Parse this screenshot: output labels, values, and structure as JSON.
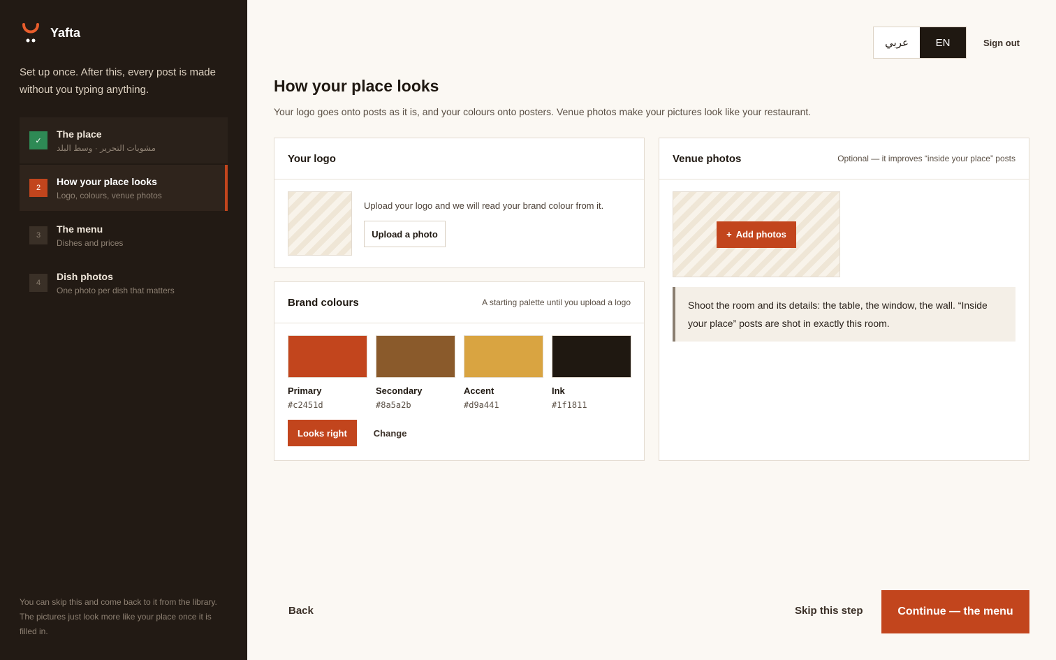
{
  "app": {
    "name": "Yafta"
  },
  "sidebar": {
    "intro": "Set up once. After this, every post is made without you typing anything.",
    "steps": [
      {
        "number": "✓",
        "title": "The place",
        "subtitle": "مشويات التحرير · وسط البلد",
        "state": "done"
      },
      {
        "number": "2",
        "title": "How your place looks",
        "subtitle": "Logo, colours, venue photos",
        "state": "active"
      },
      {
        "number": "3",
        "title": "The menu",
        "subtitle": "Dishes and prices",
        "state": "todo"
      },
      {
        "number": "4",
        "title": "Dish photos",
        "subtitle": "One photo per dish that matters",
        "state": "todo"
      }
    ],
    "footer": "You can skip this and come back to it from the library. The pictures just look more like your place once it is filled in."
  },
  "topbar": {
    "lang_ar": "عربي",
    "lang_en": "EN",
    "active_lang": "EN",
    "sign_out": "Sign out"
  },
  "main": {
    "title": "How your place looks",
    "subtitle": "Your logo goes onto posts as it is, and your colours onto posters. Venue photos make your pictures look like your restaurant."
  },
  "logo_card": {
    "title": "Your logo",
    "hint": "Upload your logo and we will read your brand colour from it.",
    "upload_label": "Upload a photo"
  },
  "colours_card": {
    "title": "Brand colours",
    "note": "A starting palette until you upload a logo",
    "swatches": [
      {
        "name": "Primary",
        "hex": "#c2451d"
      },
      {
        "name": "Secondary",
        "hex": "#8a5a2b"
      },
      {
        "name": "Accent",
        "hex": "#d9a441"
      },
      {
        "name": "Ink",
        "hex": "#1f1811"
      }
    ],
    "confirm_label": "Looks right",
    "change_label": "Change"
  },
  "venue_card": {
    "title": "Venue photos",
    "note": "Optional — it improves “inside your place” posts",
    "add_label": "Add photos",
    "tip": "Shoot the room and its details: the table, the window, the wall. “Inside your place” posts are shot in exactly this room."
  },
  "footer": {
    "back": "Back",
    "skip": "Skip this step",
    "continue": "Continue — the menu"
  },
  "colors": {
    "accent": "#c2451d",
    "sidebar_bg": "#221a14",
    "done_green": "#2e8a55",
    "page_bg": "#fbf8f3"
  },
  "icons": {
    "brand": "yafta-logo-icon",
    "check": "check-icon",
    "plus": "plus-icon"
  }
}
